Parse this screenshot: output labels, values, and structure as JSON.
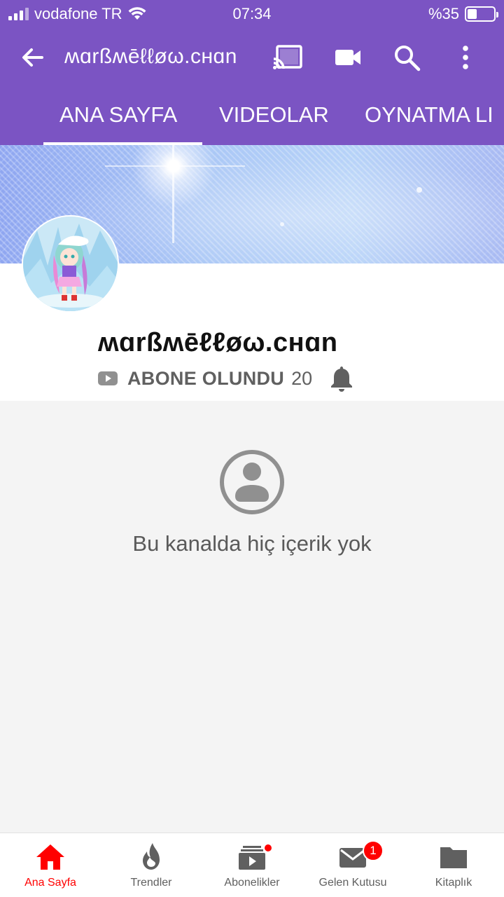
{
  "status_bar": {
    "carrier": "vodafone TR",
    "time": "07:34",
    "battery_text": "%35",
    "battery_level": 0.35
  },
  "app_bar": {
    "title": "ʍɑrßʍēℓℓøω.cʜɑn",
    "icons": [
      "back-arrow-icon",
      "cast-icon",
      "video-camera-icon",
      "search-icon",
      "more-vert-icon"
    ]
  },
  "tabs": [
    {
      "label": "ANA SAYFA",
      "active": true
    },
    {
      "label": "VIDEOLAR",
      "active": false
    },
    {
      "label": "OYNATMA LI",
      "active": false
    }
  ],
  "channel": {
    "name": "ʍɑrßʍēℓℓøω.cʜɑn",
    "subscribe_label": "ABONE OLUNDU",
    "subscriber_count": "20"
  },
  "empty_state": {
    "message": "Bu kanalda hiç içerik yok"
  },
  "bottom_nav": [
    {
      "label": "Ana Sayfa",
      "icon": "home-icon",
      "active": true
    },
    {
      "label": "Trendler",
      "icon": "fire-icon",
      "active": false
    },
    {
      "label": "Abonelikler",
      "icon": "subscriptions-icon",
      "active": false
    },
    {
      "label": "Gelen Kutusu",
      "icon": "inbox-icon",
      "active": false,
      "badge": "1"
    },
    {
      "label": "Kitaplık",
      "icon": "library-folder-icon",
      "active": false
    }
  ],
  "colors": {
    "header": "#7b54c3",
    "active_nav": "#ff0000",
    "text_secondary": "#606060"
  }
}
